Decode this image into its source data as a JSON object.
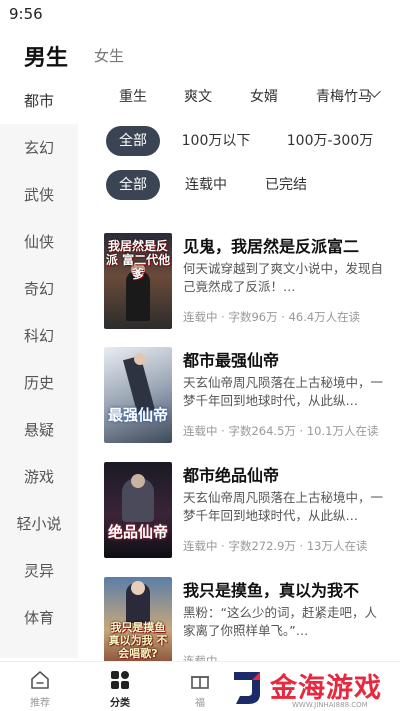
{
  "status_bar": {
    "time": "9:56"
  },
  "gender_tabs": {
    "active": "男生",
    "inactive": "女生"
  },
  "sidebar": {
    "items": [
      "都市",
      "玄幻",
      "武侠",
      "仙侠",
      "奇幻",
      "科幻",
      "历史",
      "悬疑",
      "游戏",
      "轻小说",
      "灵异",
      "体育"
    ]
  },
  "subcategories": [
    "重生",
    "爽文",
    "女婿",
    "青梅竹马"
  ],
  "filters": {
    "word_count": [
      "全部",
      "100万以下",
      "100万-300万"
    ],
    "status": [
      "全部",
      "连载中",
      "已完结"
    ]
  },
  "books": [
    {
      "title": "见鬼，我居然是反派富二",
      "desc": "何天诚穿越到了爽文小说中，发现自己竟然成了反派！…",
      "meta": "连载中 · 字数96万 · 46.4万人在读",
      "cover_text": "我居然是反派 富二代他爹"
    },
    {
      "title": "都市最强仙帝",
      "desc": "天玄仙帝周凡陨落在上古秘境中，一梦千年回到地球时代，从此纵…",
      "meta": "连载中 · 字数264.5万 · 10.1万人在读",
      "cover_text": "最强仙帝"
    },
    {
      "title": "都市绝品仙帝",
      "desc": "天玄仙帝周凡陨落在上古秘境中，一梦千年回到地球时代，从此纵…",
      "meta": "连载中 · 字数272.9万 · 13万人在读",
      "cover_text": "绝品仙帝"
    },
    {
      "title": "我只是摸鱼，真以为我不",
      "desc": "黑粉：“这么少的词，赶紧走吧，人家离了你照样单飞。”…",
      "meta": "连载中",
      "cover_text": "我只是摸鱼 真以为我 不会唱歌?"
    }
  ],
  "bottom_nav": {
    "items": [
      "推荐",
      "分类",
      "福"
    ]
  },
  "watermark": {
    "text": "金海游戏",
    "url": "WWW.JINHAI888.COM"
  },
  "colors": {
    "active_chip": "#3a4452",
    "watermark": "#e8283d"
  }
}
